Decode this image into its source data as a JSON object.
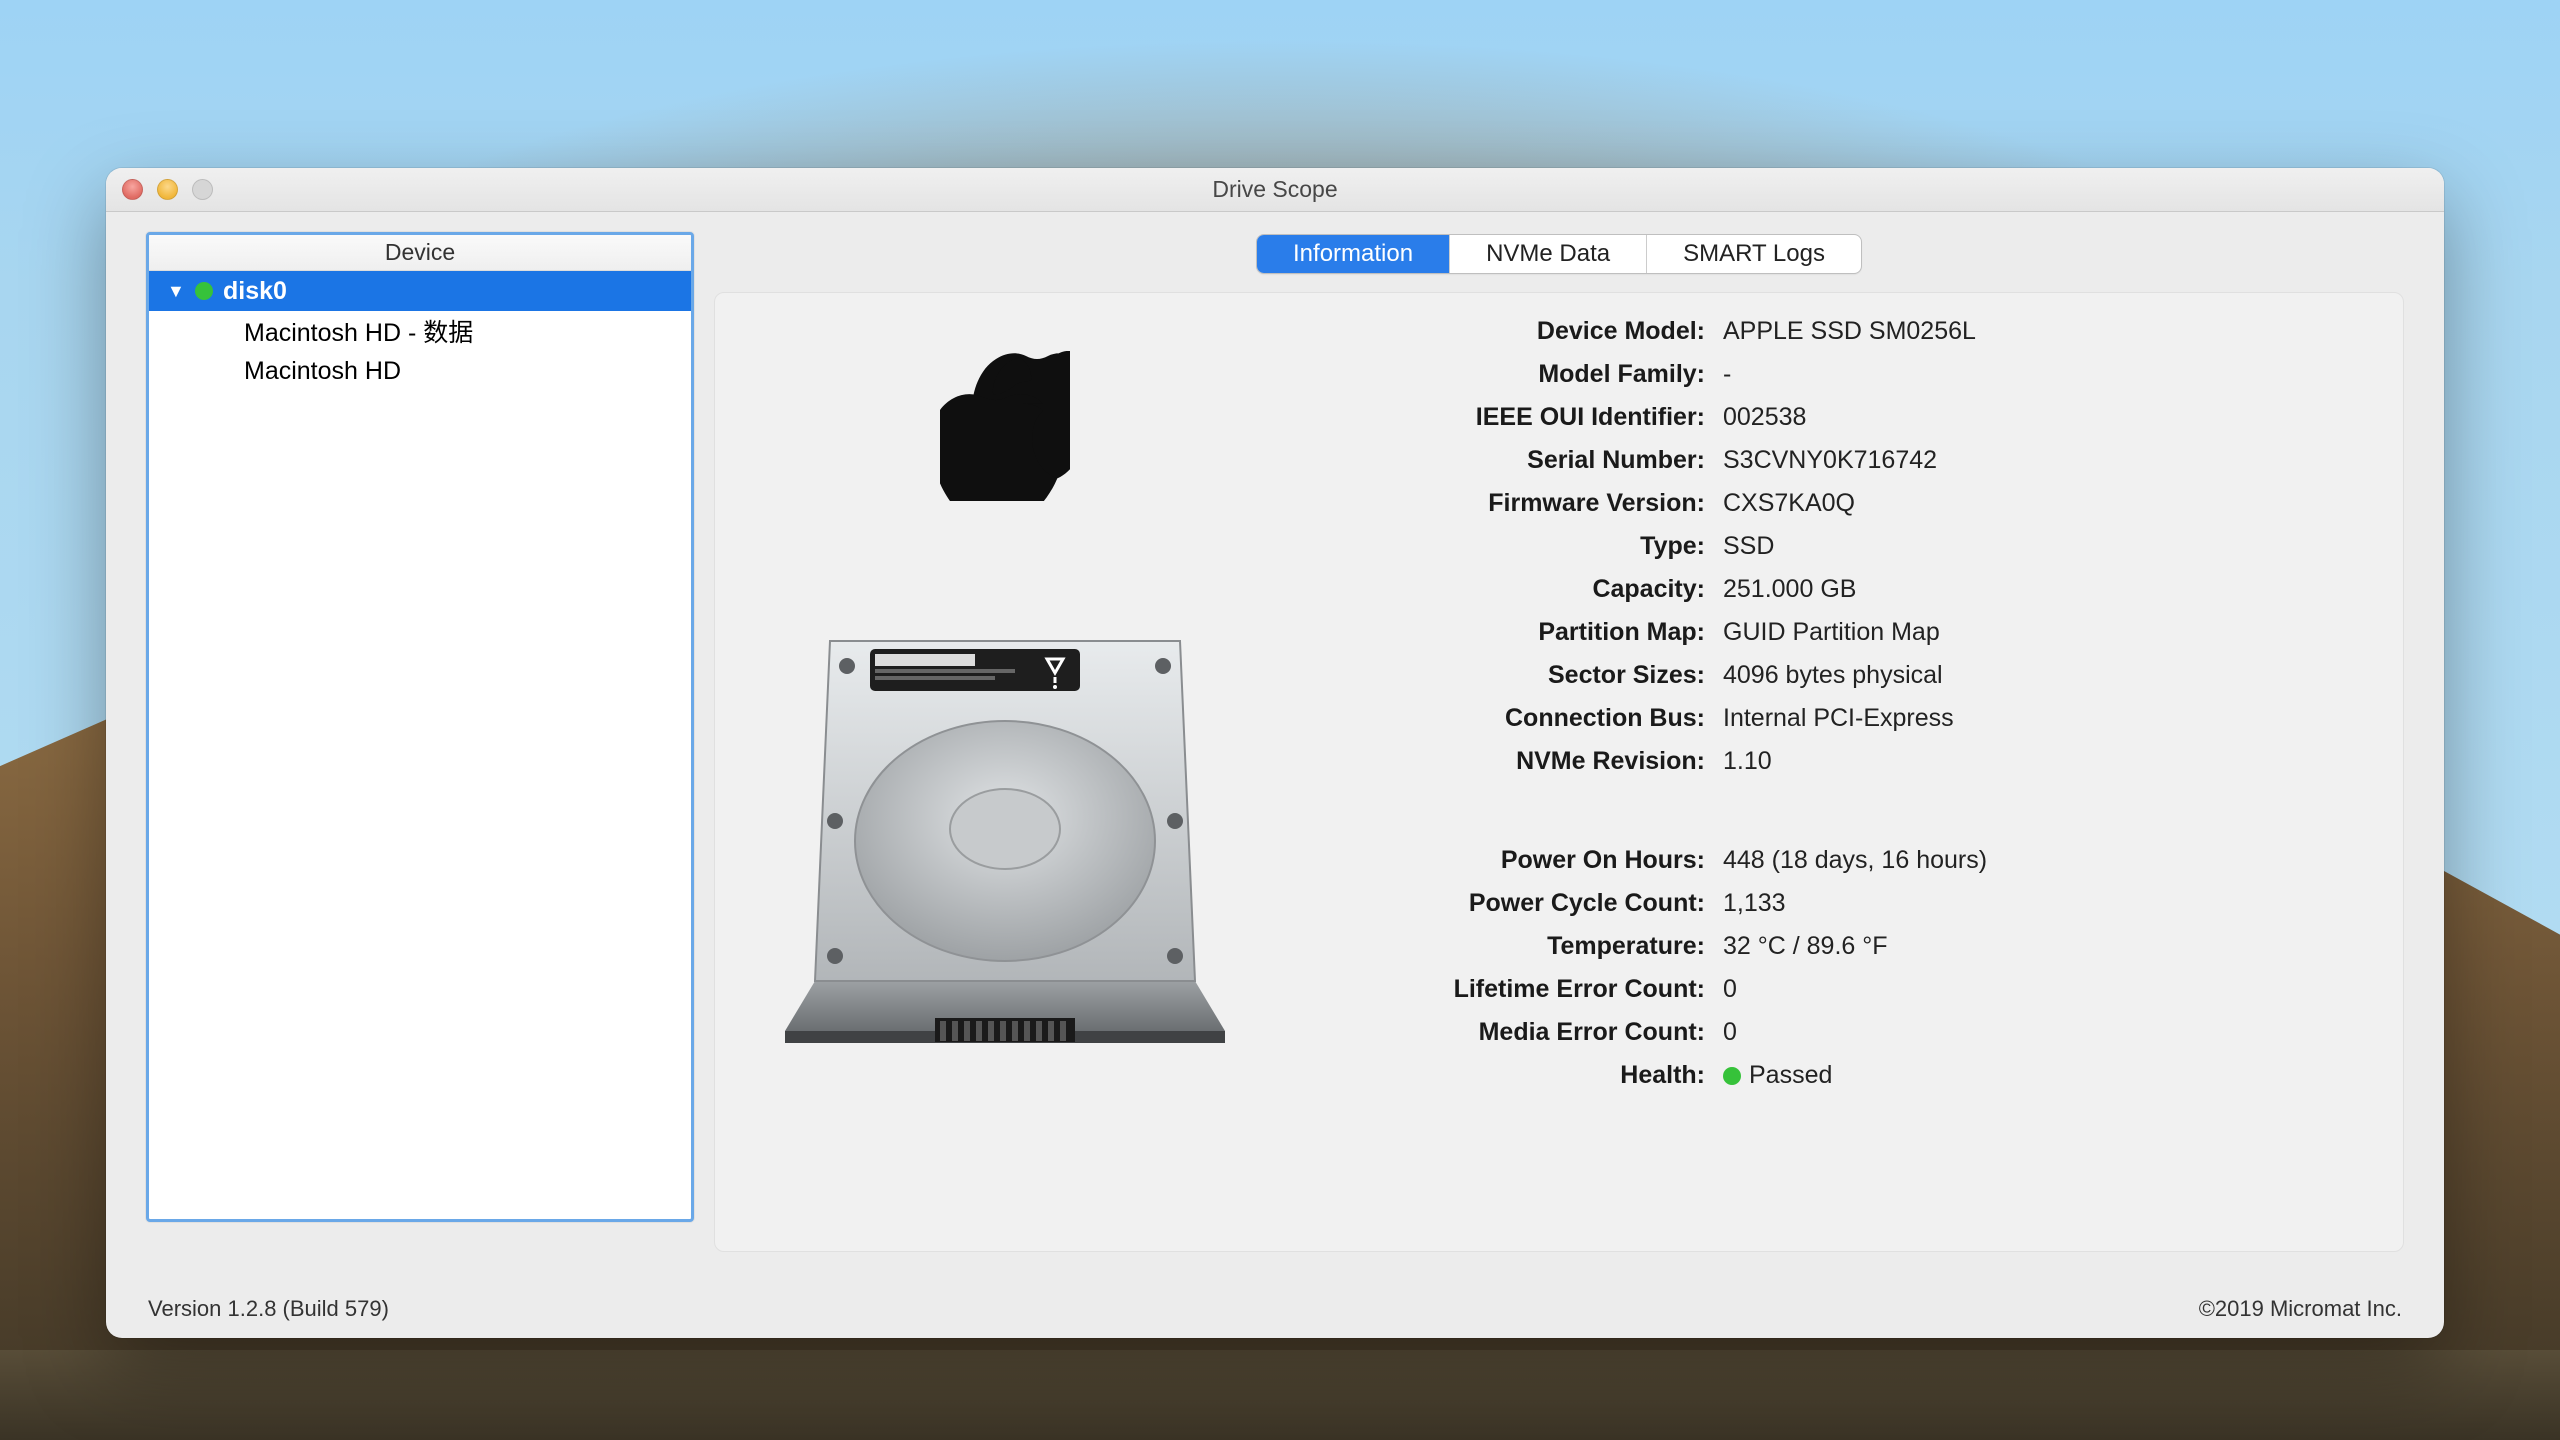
{
  "window": {
    "title": "Drive Scope"
  },
  "sidebar": {
    "header": "Device",
    "disk_name": "disk0",
    "volumes": [
      "Macintosh HD - 数据",
      "Macintosh HD"
    ]
  },
  "tabs": {
    "information": "Information",
    "nvme": "NVMe Data",
    "smart": "SMART Logs"
  },
  "info": {
    "labels": {
      "device_model": "Device Model:",
      "model_family": "Model Family:",
      "ieee_oui": "IEEE OUI Identifier:",
      "serial": "Serial Number:",
      "firmware": "Firmware Version:",
      "type": "Type:",
      "capacity": "Capacity:",
      "partition": "Partition Map:",
      "sector": "Sector Sizes:",
      "bus": "Connection Bus:",
      "nvme_rev": "NVMe Revision:",
      "power_hours": "Power On Hours:",
      "power_cycle": "Power Cycle Count:",
      "temperature": "Temperature:",
      "lifetime_err": "Lifetime Error Count:",
      "media_err": "Media Error Count:",
      "health": "Health:"
    },
    "values": {
      "device_model": "APPLE SSD SM0256L",
      "model_family": "-",
      "ieee_oui": "002538",
      "serial": "S3CVNY0K716742",
      "firmware": "CXS7KA0Q",
      "type": "SSD",
      "capacity": "251.000 GB",
      "partition": "GUID Partition Map",
      "sector": "4096 bytes physical",
      "bus": "Internal PCI-Express",
      "nvme_rev": "1.10",
      "power_hours": "448 (18 days, 16 hours)",
      "power_cycle": "1,133",
      "temperature": "32 °C / 89.6 °F",
      "lifetime_err": "0",
      "media_err": "0",
      "health": "Passed"
    }
  },
  "footer": {
    "version": "Version 1.2.8 (Build 579)",
    "copyright": "©2019 Micromat Inc."
  }
}
